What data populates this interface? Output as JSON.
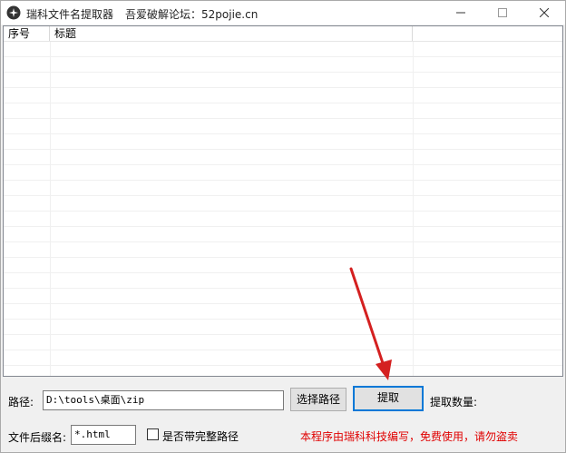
{
  "window": {
    "title": "瑞科文件名提取器",
    "title_extra": "吾爱破解论坛：52pojie.cn"
  },
  "list": {
    "columns": [
      "序号",
      "标题"
    ]
  },
  "form": {
    "path_label": "路径:",
    "path_value": "D:\\tools\\桌面\\zip",
    "select_path_button": "选择路径",
    "extract_button": "提取",
    "count_label": "提取数量:",
    "suffix_label": "文件后缀名:",
    "suffix_value": "*.html",
    "full_path_checkbox_label": "是否带完整路径",
    "full_path_checked": false
  },
  "footer": {
    "notice": "本程序由瑞科科技编写，免费使用，请勿盗卖"
  },
  "colors": {
    "notice": "#e00000",
    "arrow": "#d42020",
    "focus": "#0078d7"
  },
  "icons": [
    "app-icon",
    "minimize-icon",
    "maximize-icon",
    "close-icon",
    "red-arrow-icon"
  ]
}
